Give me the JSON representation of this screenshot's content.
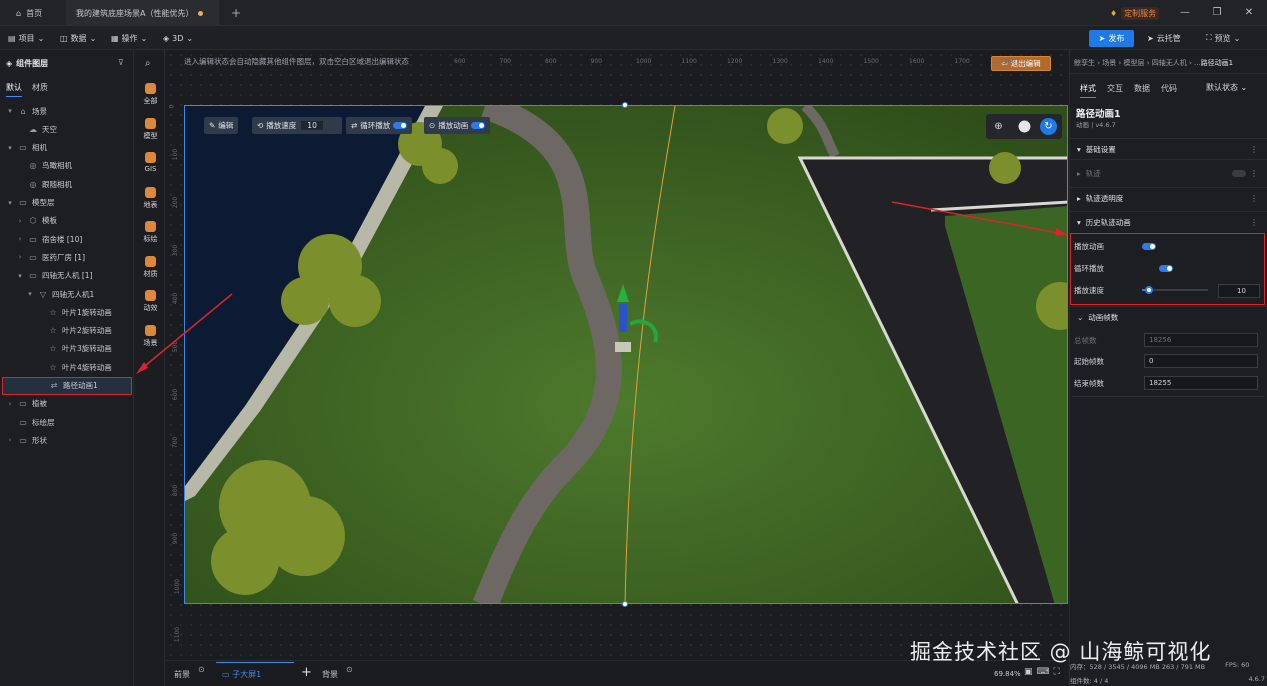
{
  "tabs": {
    "home": "首页",
    "project": "我的建筑底座场景A（性能优先）",
    "add": "+"
  },
  "top_right": {
    "service": "定制服务"
  },
  "menubar": {
    "items": [
      "项目",
      "数据",
      "操作",
      "3D"
    ],
    "publish": "发布",
    "cloud": "云托管",
    "preview": "预览"
  },
  "layers": {
    "title": "组件图层",
    "tabs": [
      "默认",
      "材质"
    ],
    "tree": [
      {
        "label": "场景",
        "level": 0,
        "arrow": "▾",
        "icon": "⌂"
      },
      {
        "label": "天空",
        "level": 1,
        "arrow": "",
        "icon": "☁"
      },
      {
        "label": "相机",
        "level": 0,
        "arrow": "▾",
        "icon": "▭"
      },
      {
        "label": "鸟瞰相机",
        "level": 1,
        "arrow": "",
        "icon": "◎"
      },
      {
        "label": "跟随相机",
        "level": 1,
        "arrow": "",
        "icon": "◎"
      },
      {
        "label": "模型层",
        "level": 0,
        "arrow": "▾",
        "icon": "▭"
      },
      {
        "label": "模板",
        "level": 1,
        "arrow": "›",
        "icon": "⬡"
      },
      {
        "label": "宿舍楼 [10]",
        "level": 1,
        "arrow": "›",
        "icon": "▭"
      },
      {
        "label": "医药厂房 [1]",
        "level": 1,
        "arrow": "›",
        "icon": "▭"
      },
      {
        "label": "四轴无人机 [1]",
        "level": 1,
        "arrow": "▾",
        "icon": "▭"
      },
      {
        "label": "四轴无人机1",
        "level": 2,
        "arrow": "▾",
        "icon": "▽"
      },
      {
        "label": "叶片1旋转动画",
        "level": 3,
        "arrow": "",
        "icon": "☆"
      },
      {
        "label": "叶片2旋转动画",
        "level": 3,
        "arrow": "",
        "icon": "☆"
      },
      {
        "label": "叶片3旋转动画",
        "level": 3,
        "arrow": "",
        "icon": "☆"
      },
      {
        "label": "叶片4旋转动画",
        "level": 3,
        "arrow": "",
        "icon": "☆"
      },
      {
        "label": "路径动画1",
        "level": 3,
        "arrow": "",
        "icon": "⇄"
      },
      {
        "label": "植被",
        "level": 0,
        "arrow": "›",
        "icon": "▭"
      },
      {
        "label": "标绘层",
        "level": 0,
        "arrow": "",
        "icon": "▭"
      },
      {
        "label": "形状",
        "level": 0,
        "arrow": "›",
        "icon": "▭"
      }
    ]
  },
  "rail": [
    {
      "label": "全部",
      "color": "#e0883a"
    },
    {
      "label": "模型",
      "color": "#e0883a"
    },
    {
      "label": "GIS",
      "color": "#e0883a"
    },
    {
      "label": "地表",
      "color": "#e0883a"
    },
    {
      "label": "标绘",
      "color": "#e0883a"
    },
    {
      "label": "材质",
      "color": "#e0883a"
    },
    {
      "label": "动效",
      "color": "#e0883a"
    },
    {
      "label": "场景",
      "color": "#e0883a"
    }
  ],
  "canvas": {
    "hint": "进入编辑状态会自动隐藏其他组件图层，双击空白区域退出编辑状态",
    "exit_edit": "退出编辑",
    "ruler_top": [
      "600",
      "700",
      "800",
      "900",
      "1000",
      "1100",
      "1200",
      "1300",
      "1400",
      "1500",
      "1600",
      "1700",
      "1800"
    ],
    "ruler_left": [
      "0",
      "100",
      "200",
      "300",
      "400",
      "500",
      "600",
      "700",
      "800",
      "900",
      "1000",
      "1100"
    ],
    "toolbar": {
      "edit": "编辑",
      "speed_label": "播放速度",
      "speed_value": "10",
      "loop": "循环播放",
      "play": "播放动画"
    }
  },
  "bottom": {
    "foreground": "前景",
    "layer": "子大屏1",
    "add": "+",
    "background": "背景",
    "zoom": "69.84%"
  },
  "props": {
    "tabs": [
      "样式",
      "交互",
      "数据",
      "代码"
    ],
    "state": "默认状态",
    "breadcrumb": "鲸孪生 › 场景 › 模型层 › 四轴无人机 › ...",
    "breadcrumb_current": "路径动画1",
    "name": "路径动画1",
    "version": "动画 | v4.6.7",
    "sections": {
      "basic": "基础设置",
      "track": "轨迹",
      "track_alpha": "轨迹透明度",
      "history": "历史轨迹动画"
    },
    "play_anim": "播放动画",
    "loop_play": "循环播放",
    "speed": "播放速度",
    "speed_value": "10",
    "speed_fraction": 0.07,
    "frames_title": "动画帧数",
    "total_frames_label": "总帧数",
    "total_frames": "18256",
    "start_label": "起始帧数",
    "start_value": "0",
    "end_label": "结束帧数",
    "end_value": "18255"
  },
  "stats": {
    "memory": "内存：528 / 3545 / 4096 MB 263 / 791 MB",
    "fps": "FPS: 60",
    "count": "组件数: 4 / 4",
    "version": "4.6.7"
  },
  "watermark": "掘金技术社区 @ 山海鲸可视化"
}
